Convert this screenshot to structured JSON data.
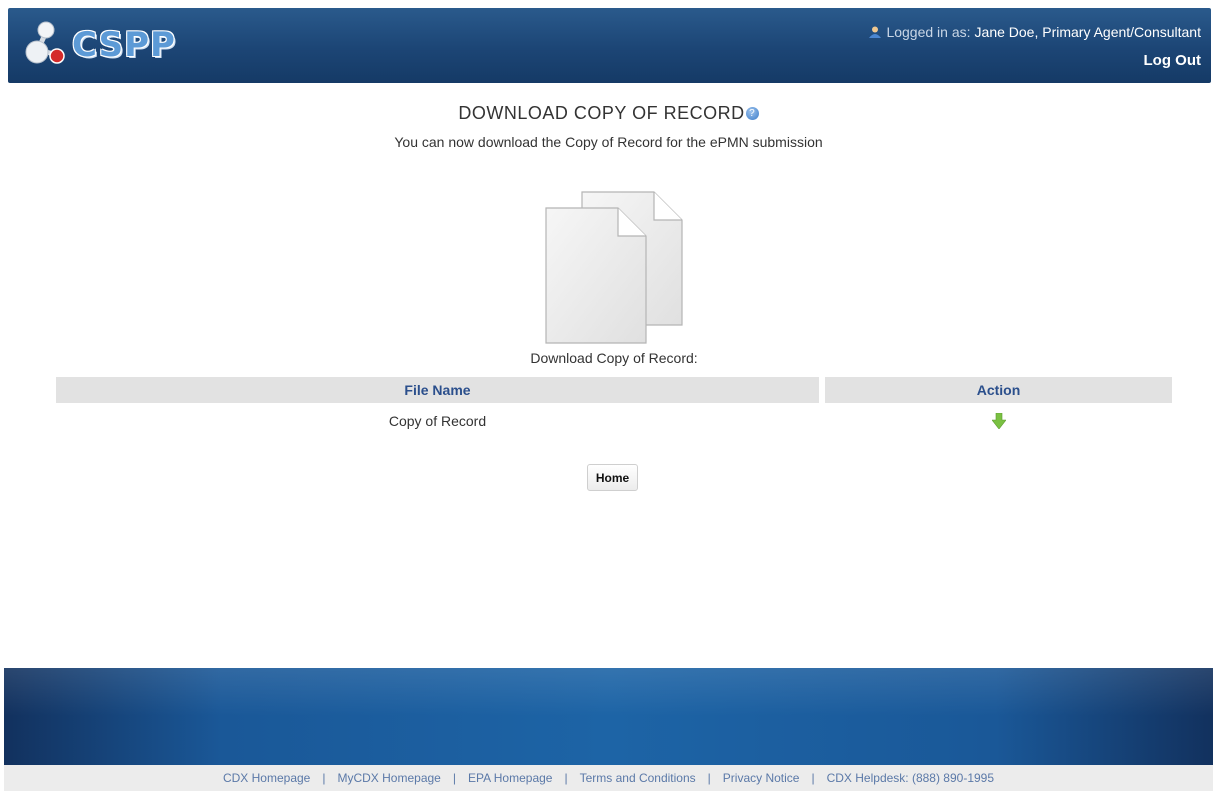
{
  "header": {
    "logo_text": "CSPP",
    "logged_in_prefix": "Logged in as:",
    "user_name": "Jane Doe, Primary Agent/Consultant",
    "logout_label": "Log Out"
  },
  "main": {
    "title": "DOWNLOAD COPY OF RECORD",
    "subtitle": "You can now download the Copy of Record for the ePMN submission",
    "download_label": "Download Copy of Record:",
    "table": {
      "headers": {
        "file_name": "File Name",
        "action": "Action"
      },
      "rows": [
        {
          "file_name": "Copy of Record",
          "action_icon": "download-arrow-icon"
        }
      ]
    },
    "home_button": "Home"
  },
  "footer": {
    "links": [
      "CDX Homepage",
      "MyCDX Homepage",
      "EPA Homepage",
      "Terms and Conditions",
      "Privacy Notice",
      "CDX Helpdesk: (888) 890-1995"
    ],
    "separator": "|"
  },
  "colors": {
    "header_blue": "#1c4575",
    "link_blue": "#5b79a8",
    "table_header_text": "#2b4f8c",
    "download_arrow_green": "#7ac142"
  }
}
